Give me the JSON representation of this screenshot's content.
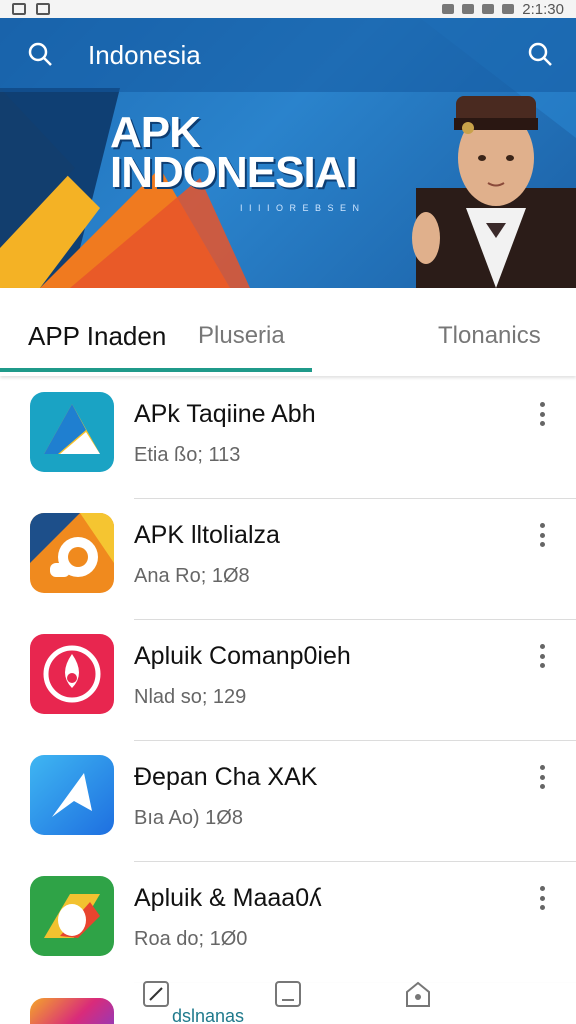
{
  "status_bar": {
    "time": "2:1:30"
  },
  "search": {
    "title": "Indonesia"
  },
  "banner": {
    "logo_line1": "APK",
    "logo_line2": "INDONESIAI",
    "logo_sub": "I I I I O R E B S E N"
  },
  "tabs": [
    {
      "label": "APP Inaden",
      "active": true
    },
    {
      "label": "Pluseria"
    },
    {
      "label": "Tlonanics"
    }
  ],
  "apps": [
    {
      "name": "APk Taqiine Abh",
      "meta": "Etia ßo; 113",
      "icon": "drive-like-icon"
    },
    {
      "name": "APK lltolialza",
      "meta": "Ana Ro; 1Ø8",
      "icon": "orange-swirl-icon"
    },
    {
      "name": "Apluik Comanp0ieh",
      "meta": "Nlad so; 129",
      "icon": "pink-drop-icon"
    },
    {
      "name": "Ðepan Cha XAK",
      "meta": "Bıa Ao) 1Ø8",
      "icon": "blue-arrow-icon"
    },
    {
      "name": "Apluik & Maaa0ʎ",
      "meta": "Roa do; 1Ø0",
      "icon": "green-leaf-icon"
    }
  ],
  "bottom_nav": {
    "label": "dslnanas"
  },
  "colors": {
    "accent": "#1f9a8a",
    "banner": "#1f6fb8"
  }
}
